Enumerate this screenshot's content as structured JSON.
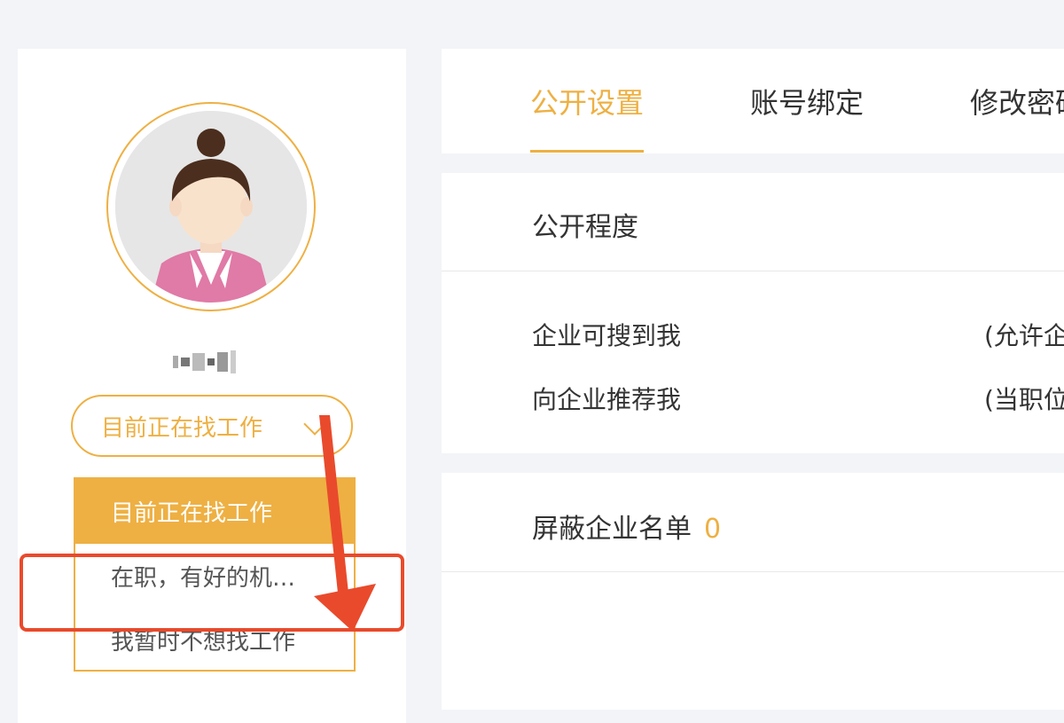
{
  "profile": {
    "status_selected": "目前正在找工作",
    "status_options": [
      "目前正在找工作",
      "在职，有好的机…",
      "我暂时不想找工作"
    ]
  },
  "tabs": [
    {
      "label": "公开设置",
      "active": true
    },
    {
      "label": "账号绑定",
      "active": false
    },
    {
      "label": "修改密码",
      "active": false
    }
  ],
  "privacy": {
    "heading": "公开程度",
    "rows": [
      {
        "label": "企业可搜到我",
        "note": "(允许企"
      },
      {
        "label": "向企业推荐我",
        "note": "(当职位"
      }
    ]
  },
  "blocklist": {
    "heading": "屏蔽企业名单",
    "count": "0"
  },
  "colors": {
    "accent": "#eeb043",
    "annotation": "#e94a2c",
    "background": "#f2f4f8"
  }
}
